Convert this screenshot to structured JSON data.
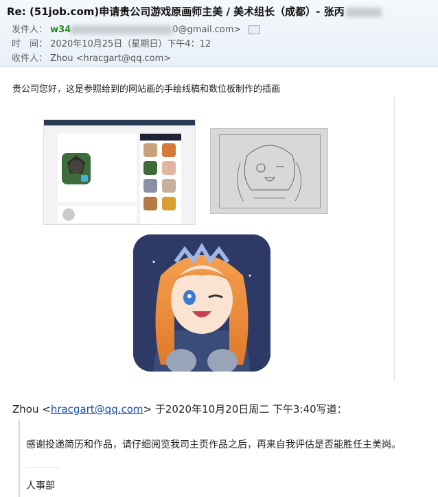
{
  "email": {
    "subject_prefix": "Re: (51job.com)申请贵公司游戏原画师主美 / 美术组长（成都）- 张",
    "subject_tail": "丙",
    "from_label": "发件人：",
    "from_name_partial": "w34",
    "from_email_tail": "0@gmail.com>",
    "time_label": "时　间：",
    "time_value": "2020年10月25日（星期日）下午4：12",
    "to_label": "收件人：",
    "to_value": "Zhou <hracgart@qq.com>"
  },
  "body": {
    "greeting": "贵公司您好，这是参照给到的网站画的手绘线稿和数位板制作的插画"
  },
  "reply": {
    "name": "Zhou <",
    "email": "hracgart@qq.com",
    "suffix": "> 于2020年10月20日周二 下午3:40写道：",
    "quote_text": "感谢投递简历和作品，请仔细阅览我司主页作品之后，再来自我评估是否能胜任主美岗。",
    "signature": "人事部"
  },
  "colors": {
    "sender": "#1e8a1e",
    "link": "#1a4fb0",
    "header_bg": "#eef3f9"
  }
}
